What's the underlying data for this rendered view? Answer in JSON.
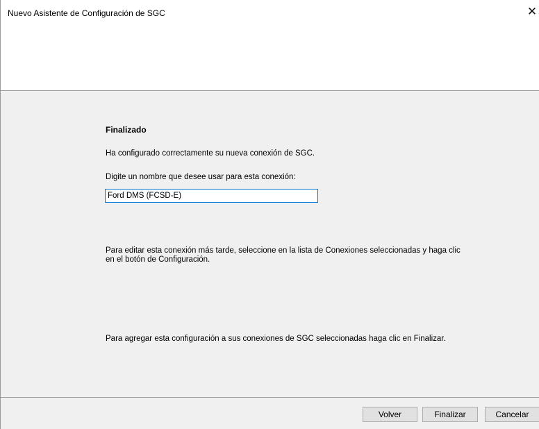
{
  "window": {
    "title": "Nuevo Asistente de Configuración de SGC",
    "close_glyph": "✕",
    "close_icon": "close-icon"
  },
  "content": {
    "heading": "Finalizado",
    "success_text": "Ha configurado correctamente su nueva conexión de SGC.",
    "name_prompt": "Digite un nombre que desee usar para esta conexión:",
    "connection_name": {
      "value": "Ford DMS (FCSD-E)",
      "placeholder": ""
    },
    "edit_hint": "Para editar esta conexión más tarde, seleccione en la lista de Conexiones seleccionadas y haga clic en el botón de Configuración.",
    "finish_hint": "Para agregar esta configuración a sus conexiones de SGC seleccionadas haga clic en Finalizar."
  },
  "footer": {
    "back_label": "Volver",
    "finish_label": "Finalizar",
    "cancel_label": "Cancelar"
  },
  "colors": {
    "content_bg": "#f0f0f0",
    "input_border_focus": "#0078d7",
    "button_bg": "#e1e1e1",
    "divider": "#a0a0a0"
  }
}
